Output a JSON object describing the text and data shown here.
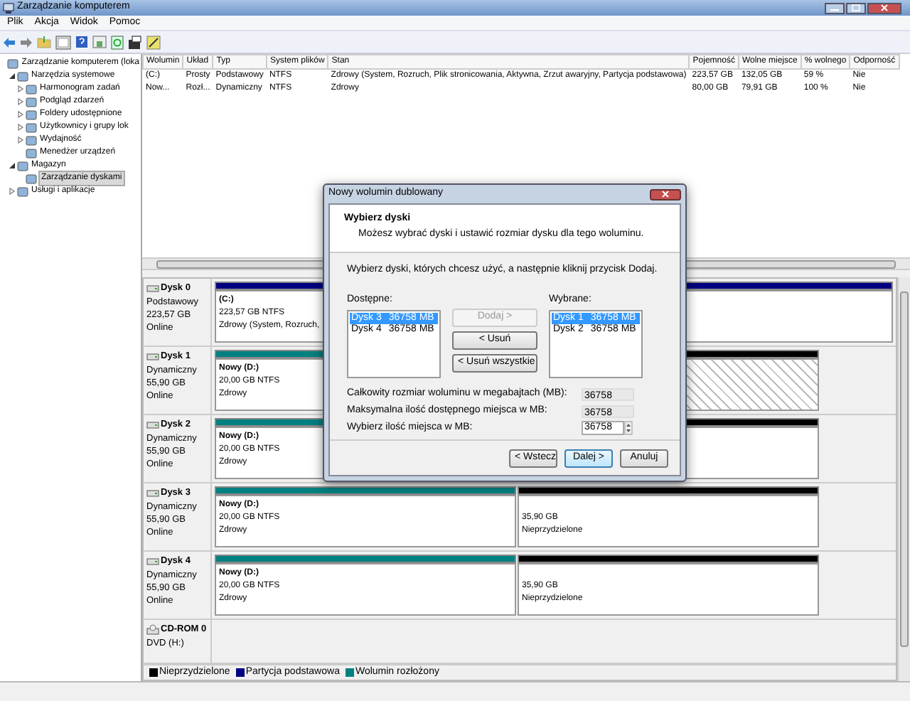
{
  "window": {
    "title": "Zarządzanie komputerem"
  },
  "menu": [
    "Plik",
    "Akcja",
    "Widok",
    "Pomoc"
  ],
  "tree": [
    {
      "label": "Zarządzanie komputerem (loka",
      "selected": false,
      "children": [
        {
          "label": "Narzędzia systemowe",
          "selected": false,
          "expanded": true,
          "children": [
            {
              "label": "Harmonogram zadań",
              "selected": false,
              "expanded": false
            },
            {
              "label": "Podgląd zdarzeń",
              "selected": false,
              "expanded": false
            },
            {
              "label": "Foldery udostępnione",
              "selected": false,
              "expanded": false
            },
            {
              "label": "Użytkownicy i grupy lok",
              "selected": false,
              "expanded": false
            },
            {
              "label": "Wydajność",
              "selected": false,
              "expanded": false
            },
            {
              "label": "Menedżer urządzeń",
              "selected": false
            }
          ]
        },
        {
          "label": "Magazyn",
          "selected": false,
          "expanded": true,
          "children": [
            {
              "label": "Zarządzanie dyskami",
              "selected": true
            }
          ]
        },
        {
          "label": "Usługi i aplikacje",
          "selected": false,
          "expanded": false
        }
      ]
    }
  ],
  "volumes": {
    "columns": [
      "Wolumin",
      "Układ",
      "Typ",
      "System plików",
      "Stan",
      "Pojemność",
      "Wolne miejsce",
      "% wolnego",
      "Odporność"
    ],
    "rows": [
      [
        "(C:)",
        "Prosty",
        "Podstawowy",
        "NTFS",
        "Zdrowy (System, Rozruch, Plik stronicowania, Aktywna, Zrzut awaryjny, Partycja podstawowa)",
        "223,57 GB",
        "132,05 GB",
        "59 %",
        "Nie"
      ],
      [
        "Now...",
        "Rozł...",
        "Dynamiczny",
        "NTFS",
        "Zdrowy",
        "80,00 GB",
        "79,91 GB",
        "100 %",
        "Nie"
      ]
    ]
  },
  "disks": [
    {
      "kind": "disk",
      "name": "Dysk 0",
      "lines": [
        "Podstawowy",
        "223,57 GB",
        "Online"
      ],
      "partitions": [
        {
          "color": "#000080",
          "selected": false,
          "title": "(C:)",
          "lines": [
            "223,57 GB NTFS",
            "Zdrowy (System, Rozruch,"
          ]
        }
      ]
    },
    {
      "kind": "disk",
      "name": "Dysk 1",
      "lines": [
        "Dynamiczny",
        "55,90 GB",
        "Online"
      ],
      "partitions": [
        {
          "color": "#008080",
          "selected": false,
          "title": "Nowy  (D:)",
          "lines": [
            "20,00 GB NTFS",
            "Zdrowy"
          ]
        },
        {
          "color": "#000000",
          "selected": true
        }
      ]
    },
    {
      "kind": "disk",
      "name": "Dysk 2",
      "lines": [
        "Dynamiczny",
        "55,90 GB",
        "Online"
      ],
      "partitions": [
        {
          "color": "#008080",
          "selected": false,
          "title": "Nowy  (D:)",
          "lines": [
            "20,00 GB NTFS",
            "Zdrowy"
          ]
        },
        {
          "color": "#000000",
          "selected": false
        }
      ]
    },
    {
      "kind": "disk",
      "name": "Dysk 3",
      "lines": [
        "Dynamiczny",
        "55,90 GB",
        "Online"
      ],
      "partitions": [
        {
          "color": "#008080",
          "selected": false,
          "title": "Nowy  (D:)",
          "lines": [
            "20,00 GB NTFS",
            "Zdrowy"
          ]
        },
        {
          "color": "#000000",
          "selected": false,
          "lines": [
            "35,90 GB",
            "Nieprzydzielone"
          ]
        }
      ]
    },
    {
      "kind": "disk",
      "name": "Dysk 4",
      "lines": [
        "Dynamiczny",
        "55,90 GB",
        "Online"
      ],
      "partitions": [
        {
          "color": "#008080",
          "selected": false,
          "title": "Nowy  (D:)",
          "lines": [
            "20,00 GB NTFS",
            "Zdrowy"
          ]
        },
        {
          "color": "#000000",
          "selected": false,
          "lines": [
            "35,90 GB",
            "Nieprzydzielone"
          ]
        }
      ]
    },
    {
      "kind": "cdrom",
      "name": "CD-ROM 0",
      "lines": [
        "DVD (H:)"
      ]
    }
  ],
  "legend": [
    {
      "label": "Nieprzydzielone",
      "color": "#000000"
    },
    {
      "label": "Partycja podstawowa",
      "color": "#000080"
    },
    {
      "label": "Wolumin rozłożony",
      "color": "#008080"
    }
  ],
  "dialog": {
    "title": "Nowy wolumin dublowany",
    "heading": "Wybierz dyski",
    "subtitle": "Możesz wybrać dyski i ustawić rozmiar dysku dla tego woluminu.",
    "instruction": "Wybierz dyski, których chcesz użyć, a następnie kliknij przycisk Dodaj.",
    "available": {
      "label": "Dostępne:",
      "items": [
        {
          "name": "Dysk 3",
          "size": "36758 MB",
          "selected": true
        },
        {
          "name": "Dysk 4",
          "size": "36758 MB",
          "selected": false
        }
      ]
    },
    "selected_list": {
      "label": "Wybrane:",
      "items": [
        {
          "name": "Dysk 1",
          "size": "36758 MB",
          "selected": true
        },
        {
          "name": "Dysk 2",
          "size": "36758 MB",
          "selected": false
        }
      ]
    },
    "move_buttons": [
      {
        "label": "Dodaj >",
        "disabled": true
      },
      {
        "label": "< Usuń",
        "disabled": false
      },
      {
        "label": "< Usuń wszystkie",
        "disabled": false
      }
    ],
    "fields": [
      {
        "kind": "readonly",
        "label": "Całkowity rozmiar woluminu w megabajtach (MB):",
        "value": "36758"
      },
      {
        "kind": "readonly",
        "label": "Maksymalna ilość dostępnego miejsca w MB:",
        "value": "36758"
      },
      {
        "kind": "spin",
        "label": "Wybierz ilość miejsca w MB:",
        "value": "36758"
      }
    ],
    "buttons": [
      {
        "label": "< Wstecz",
        "default": false
      },
      {
        "label": "Dalej >",
        "default": true
      },
      {
        "label": "Anuluj",
        "default": false
      }
    ]
  }
}
